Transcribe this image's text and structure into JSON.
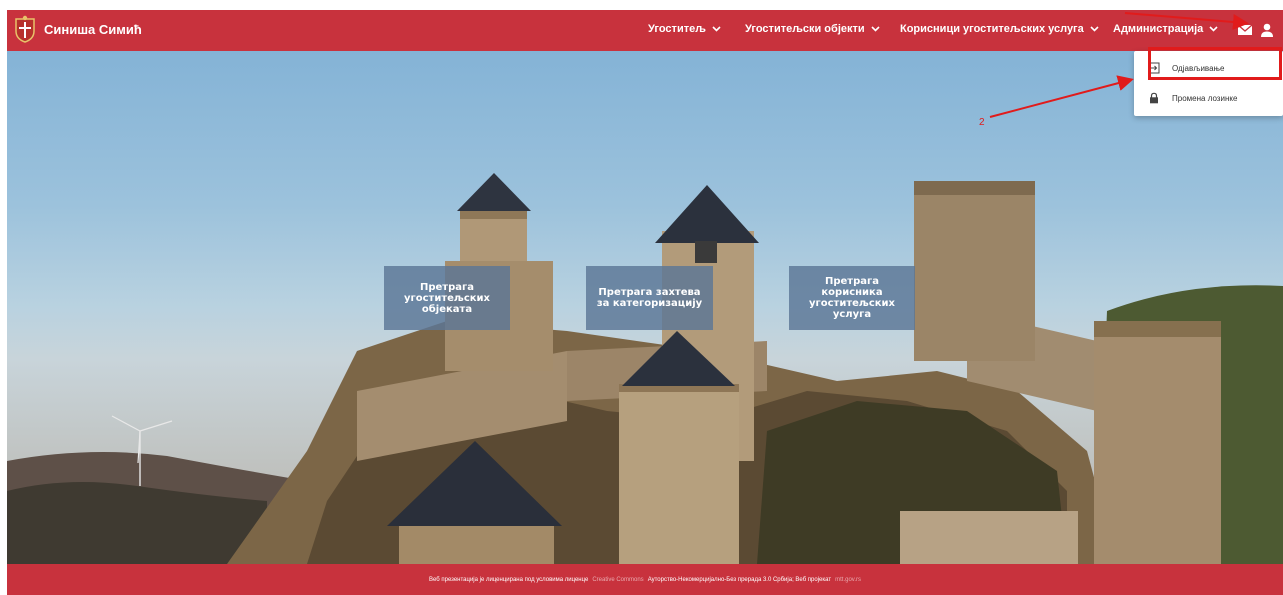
{
  "header": {
    "brand_name": "Синиша Симић",
    "nav": [
      {
        "label": "Угоститељ"
      },
      {
        "label": "Угоститељски објекти"
      },
      {
        "label": "Корисници угоститељских услуга"
      },
      {
        "label": "Администрација"
      }
    ],
    "icons": [
      "serbia-crest-icon",
      "mail-icon",
      "user-icon",
      "chevron-down-icon"
    ]
  },
  "user_menu": {
    "items": [
      {
        "label": "Одјављивање",
        "icon": "logout-icon"
      },
      {
        "label": "Промена лозинке",
        "icon": "lock-icon"
      }
    ],
    "annotation_step": "2"
  },
  "hero": {
    "tiles": [
      {
        "label": "Претрага угоститељских објеката"
      },
      {
        "label": "Претрага захтева за категоризацију"
      },
      {
        "label": "Претрага корисника угоститељских услуга"
      }
    ]
  },
  "footer": {
    "license_text": "Веб презентација је лиценцирана под условима лиценце",
    "license_link": "Creative Commons",
    "license_type": "Ауторство-Некомерцијално-Без прерада 3.0 Србија; Веб пројекат",
    "site_link": "mtt.gov.rs"
  },
  "colors": {
    "brand_red": "#c8323d",
    "annotation_red": "#e11b1b",
    "tile_bg": "#5c7696"
  }
}
